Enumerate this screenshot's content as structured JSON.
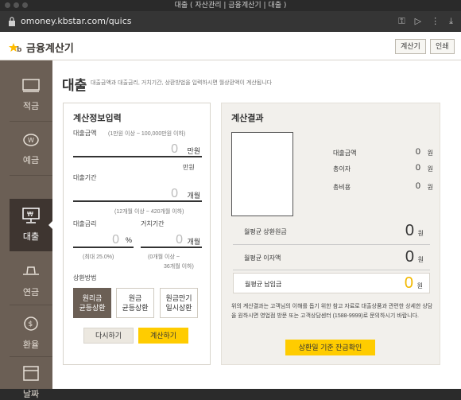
{
  "window": {
    "title": "대출 ( 자산관리 | 금융계산기 | 대출 )"
  },
  "browser": {
    "url": "omoney.kbstar.com/quics"
  },
  "header": {
    "brand": "금융계산기",
    "calc_button": "계산기",
    "print_button": "인쇄"
  },
  "sidebar": {
    "items": [
      {
        "label": "적금",
        "icon": "savings-icon"
      },
      {
        "label": "예금",
        "icon": "piggy-bank-icon"
      },
      {
        "label": "대출",
        "icon": "loan-monitor-icon",
        "active": true
      },
      {
        "label": "연금",
        "icon": "hat-icon"
      },
      {
        "label": "환율",
        "icon": "exchange-icon"
      },
      {
        "label": "날짜",
        "icon": "calendar-icon"
      }
    ]
  },
  "page": {
    "title": "대출",
    "subtitle": "대출금액과 대출금리, 거치기간, 상환방법을 입력하시면 월상환액이 계산됩니다"
  },
  "input_panel": {
    "heading": "계산정보입력",
    "amount": {
      "label": "대출금액",
      "hint": "(1만원 이상 ~ 100,000만원 이하)",
      "value": "0",
      "unit": "만원",
      "unit_below": "만원"
    },
    "period": {
      "label": "대출기간",
      "hint": "(12개월 이상 ~ 420개월 이하)",
      "value": "0",
      "unit": "개월"
    },
    "rate": {
      "label": "대출금리",
      "hint": "(최대 25.0%)",
      "value": "0",
      "unit": "%"
    },
    "grace": {
      "label": "거치기간",
      "hint_line1": "(0개월 이상 ~",
      "hint_line2": "36개월 이하)",
      "value": "0",
      "unit": "개월"
    },
    "repay": {
      "label": "상환방법",
      "options": [
        {
          "line1": "원리금",
          "line2": "균등상환",
          "selected": true
        },
        {
          "line1": "원금",
          "line2": "균등상환",
          "selected": false
        },
        {
          "line1": "원금만기",
          "line2": "일시상환",
          "selected": false
        }
      ]
    },
    "reset_button": "다시하기",
    "calc_button": "계산하기"
  },
  "result_panel": {
    "heading": "계산결과",
    "totals": [
      {
        "label": "대출금액",
        "value": "0",
        "unit": "원"
      },
      {
        "label": "총이자",
        "value": "0",
        "unit": "원"
      },
      {
        "label": "총비용",
        "value": "0",
        "unit": "원"
      }
    ],
    "monthly": [
      {
        "label": "월평균 상환원금",
        "value": "0",
        "unit": "원"
      },
      {
        "label": "월평균 이자액",
        "value": "0",
        "unit": "원"
      },
      {
        "label": "월평균 납입금",
        "value": "0",
        "unit": "원"
      }
    ],
    "note": "위의 계산결과는 고객님의 이해를 돕기 위한 참고 자료로 대출상품과 관련한 상세한 상담을 원하시면 영업점 방문 또는 고객상담센터 (1588-9999)로 문의하시기 바랍니다.",
    "balance_button": "상환일 기준 잔금확인"
  },
  "colors": {
    "accent": "#ffcc00",
    "sidebar": "#6b5f55",
    "sidebar_active": "#3e3530"
  }
}
